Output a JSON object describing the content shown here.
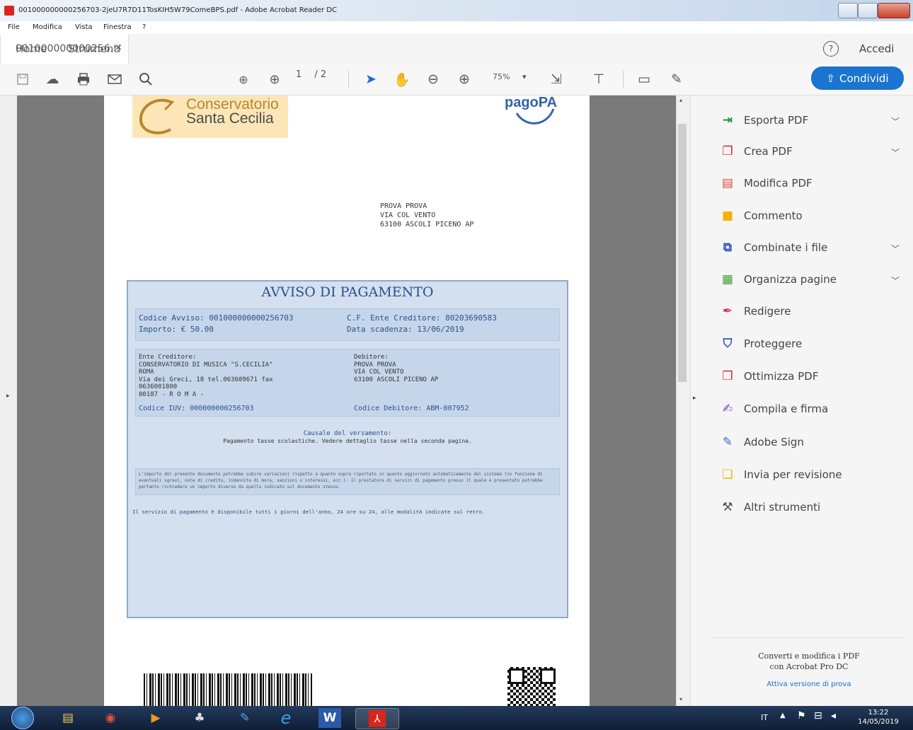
{
  "window": {
    "title": "001000000000256703-2jeU7R7D11TosKIH5W79ComeBPS.pdf - Adobe Acrobat Reader DC"
  },
  "menu": [
    "File",
    "Modifica",
    "Vista",
    "Finestra",
    "?"
  ],
  "tabs": {
    "home": "Home",
    "tools": "Strumenti",
    "document": "001000000000256...",
    "close": "×",
    "signin": "Accedi"
  },
  "toolbar": {
    "page_current": "1",
    "page_total": "/ 2",
    "zoom": "75%",
    "share_label": "Condividi"
  },
  "document": {
    "logo_line1": "Conservatorio",
    "logo_line2": "Santa Cecilia",
    "pagopa": "pagoPA",
    "recipient": [
      "PROVA PROVA",
      "VIA COL VENTO",
      "63100 ASCOLI PICENO AP"
    ],
    "notice_title": "AVVISO DI PAGAMENTO",
    "codice_avviso": "Codice Avviso: 001000000000256703",
    "importo": "Importo: € 50.00",
    "cf_ente": "C.F. Ente Creditore: 80203690583",
    "scadenza": "Data scadenza: 13/06/2019",
    "ente_label": "Ente Creditore:",
    "ente_lines": [
      "CONSERVATORIO DI MUSICA \"S.CECILIA\"",
      "ROMA",
      "Via dei Greci, 18  tel.063609671 fax",
      "0636001800",
      "00187 - R O M A -"
    ],
    "iuv": "Codice IUV: 000000000256703",
    "debitore_label": "Debitore:",
    "debitore_lines": [
      "PROVA PROVA",
      "VIA COL VENTO",
      "63100 ASCOLI PICENO AP"
    ],
    "codice_debitore": "Codice Debitore: ABM-007952",
    "causale_label": "Causale del versamento:",
    "causale_text": "Pagamento tasse scolastiche. Vedere dettaglio tasse nella seconda pagina.",
    "legal_text": "L'importo del presente documento potrebbe subire variazioni rispetto a quanto sopra riportato in quanto aggiornato automaticamente dal sistema (in funzione di eventuali sgravi, note di credito, indennita di mora, sanzioni o interessi, ecc.). Il prestatore di servizi di pagamento presso il quale è presentato potrebbe pertanto richiedere un importo diverso da quello indicato sul documento stesso.",
    "service_text": "Il servizio di pagamento è disponibile tutti i giorni dell'anno, 24 ore su 24, alle modalità indicate sul retro."
  },
  "rightpane": {
    "tools": [
      {
        "label": "Esporta PDF",
        "icon": "export-pdf-icon",
        "color": "#1e8f3a",
        "chevron": true
      },
      {
        "label": "Crea PDF",
        "icon": "create-pdf-icon",
        "color": "#d8262b",
        "chevron": true
      },
      {
        "label": "Modifica PDF",
        "icon": "edit-pdf-icon",
        "color": "#e2473b",
        "chevron": false
      },
      {
        "label": "Commento",
        "icon": "comment-icon",
        "color": "#f0b400",
        "chevron": false
      },
      {
        "label": "Combinate i file",
        "icon": "combine-files-icon",
        "color": "#3158b8",
        "chevron": true
      },
      {
        "label": "Organizza pagine",
        "icon": "organize-pages-icon",
        "color": "#3d9e36",
        "chevron": true
      },
      {
        "label": "Redigere",
        "icon": "redact-icon",
        "color": "#d8346b",
        "chevron": false
      },
      {
        "label": "Proteggere",
        "icon": "protect-icon",
        "color": "#3a4ec0",
        "chevron": false
      },
      {
        "label": "Ottimizza PDF",
        "icon": "optimize-pdf-icon",
        "color": "#d8262b",
        "chevron": false
      },
      {
        "label": "Compila e firma",
        "icon": "fill-sign-icon",
        "color": "#6a4bc2",
        "chevron": false
      },
      {
        "label": "Adobe Sign",
        "icon": "adobe-sign-icon",
        "color": "#3c68c8",
        "chevron": false
      },
      {
        "label": "Invia per revisione",
        "icon": "send-review-icon",
        "color": "#e8b800",
        "chevron": false
      },
      {
        "label": "Altri strumenti",
        "icon": "more-tools-icon",
        "color": "#555555",
        "chevron": false
      }
    ],
    "promo_line1": "Converti e modifica i PDF",
    "promo_line2": "con Acrobat Pro DC",
    "promo_link": "Attiva versione di prova"
  },
  "taskbar": {
    "lang": "IT",
    "time": "13:22",
    "date": "14/05/2019"
  }
}
